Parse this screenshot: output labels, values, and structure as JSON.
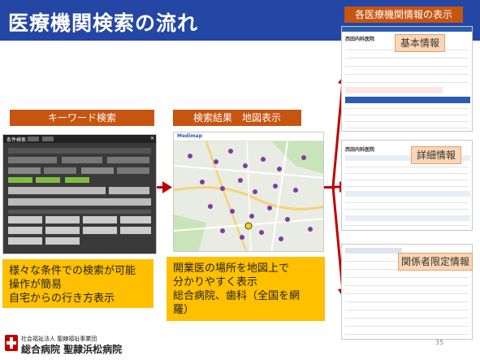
{
  "title": "医療機関検索の流れ",
  "steps": {
    "keyword": "キーワード検索",
    "result": "検索結果　地図表示",
    "detail_header": "各医療機関情報の表示"
  },
  "desc_left": [
    "様々な条件での検索が可能",
    "操作が簡易",
    "自宅からの行き方表示"
  ],
  "desc_mid": [
    "開業医の場所を地図上で",
    "分かりやすく表示",
    "総合病院、歯科（全国を網",
    "羅）"
  ],
  "info_tags": [
    "基本情報",
    "詳細情報",
    "関係者限定情報"
  ],
  "mini_ui": {
    "search_title": "条件検索",
    "map_logo": "Medimap",
    "clinic_name": "西田内科医院"
  },
  "footer": {
    "org_small": "社会福祉法人 聖隷福祉事業団",
    "org_large": "総合病院 聖隷浜松病院"
  },
  "page_number": "35",
  "colors": {
    "title_bar": "#2446a5",
    "step_label": "#c7540f",
    "desc_box": "#ffc000",
    "arrow": "#c00000",
    "tag": "#fcd5b4"
  }
}
